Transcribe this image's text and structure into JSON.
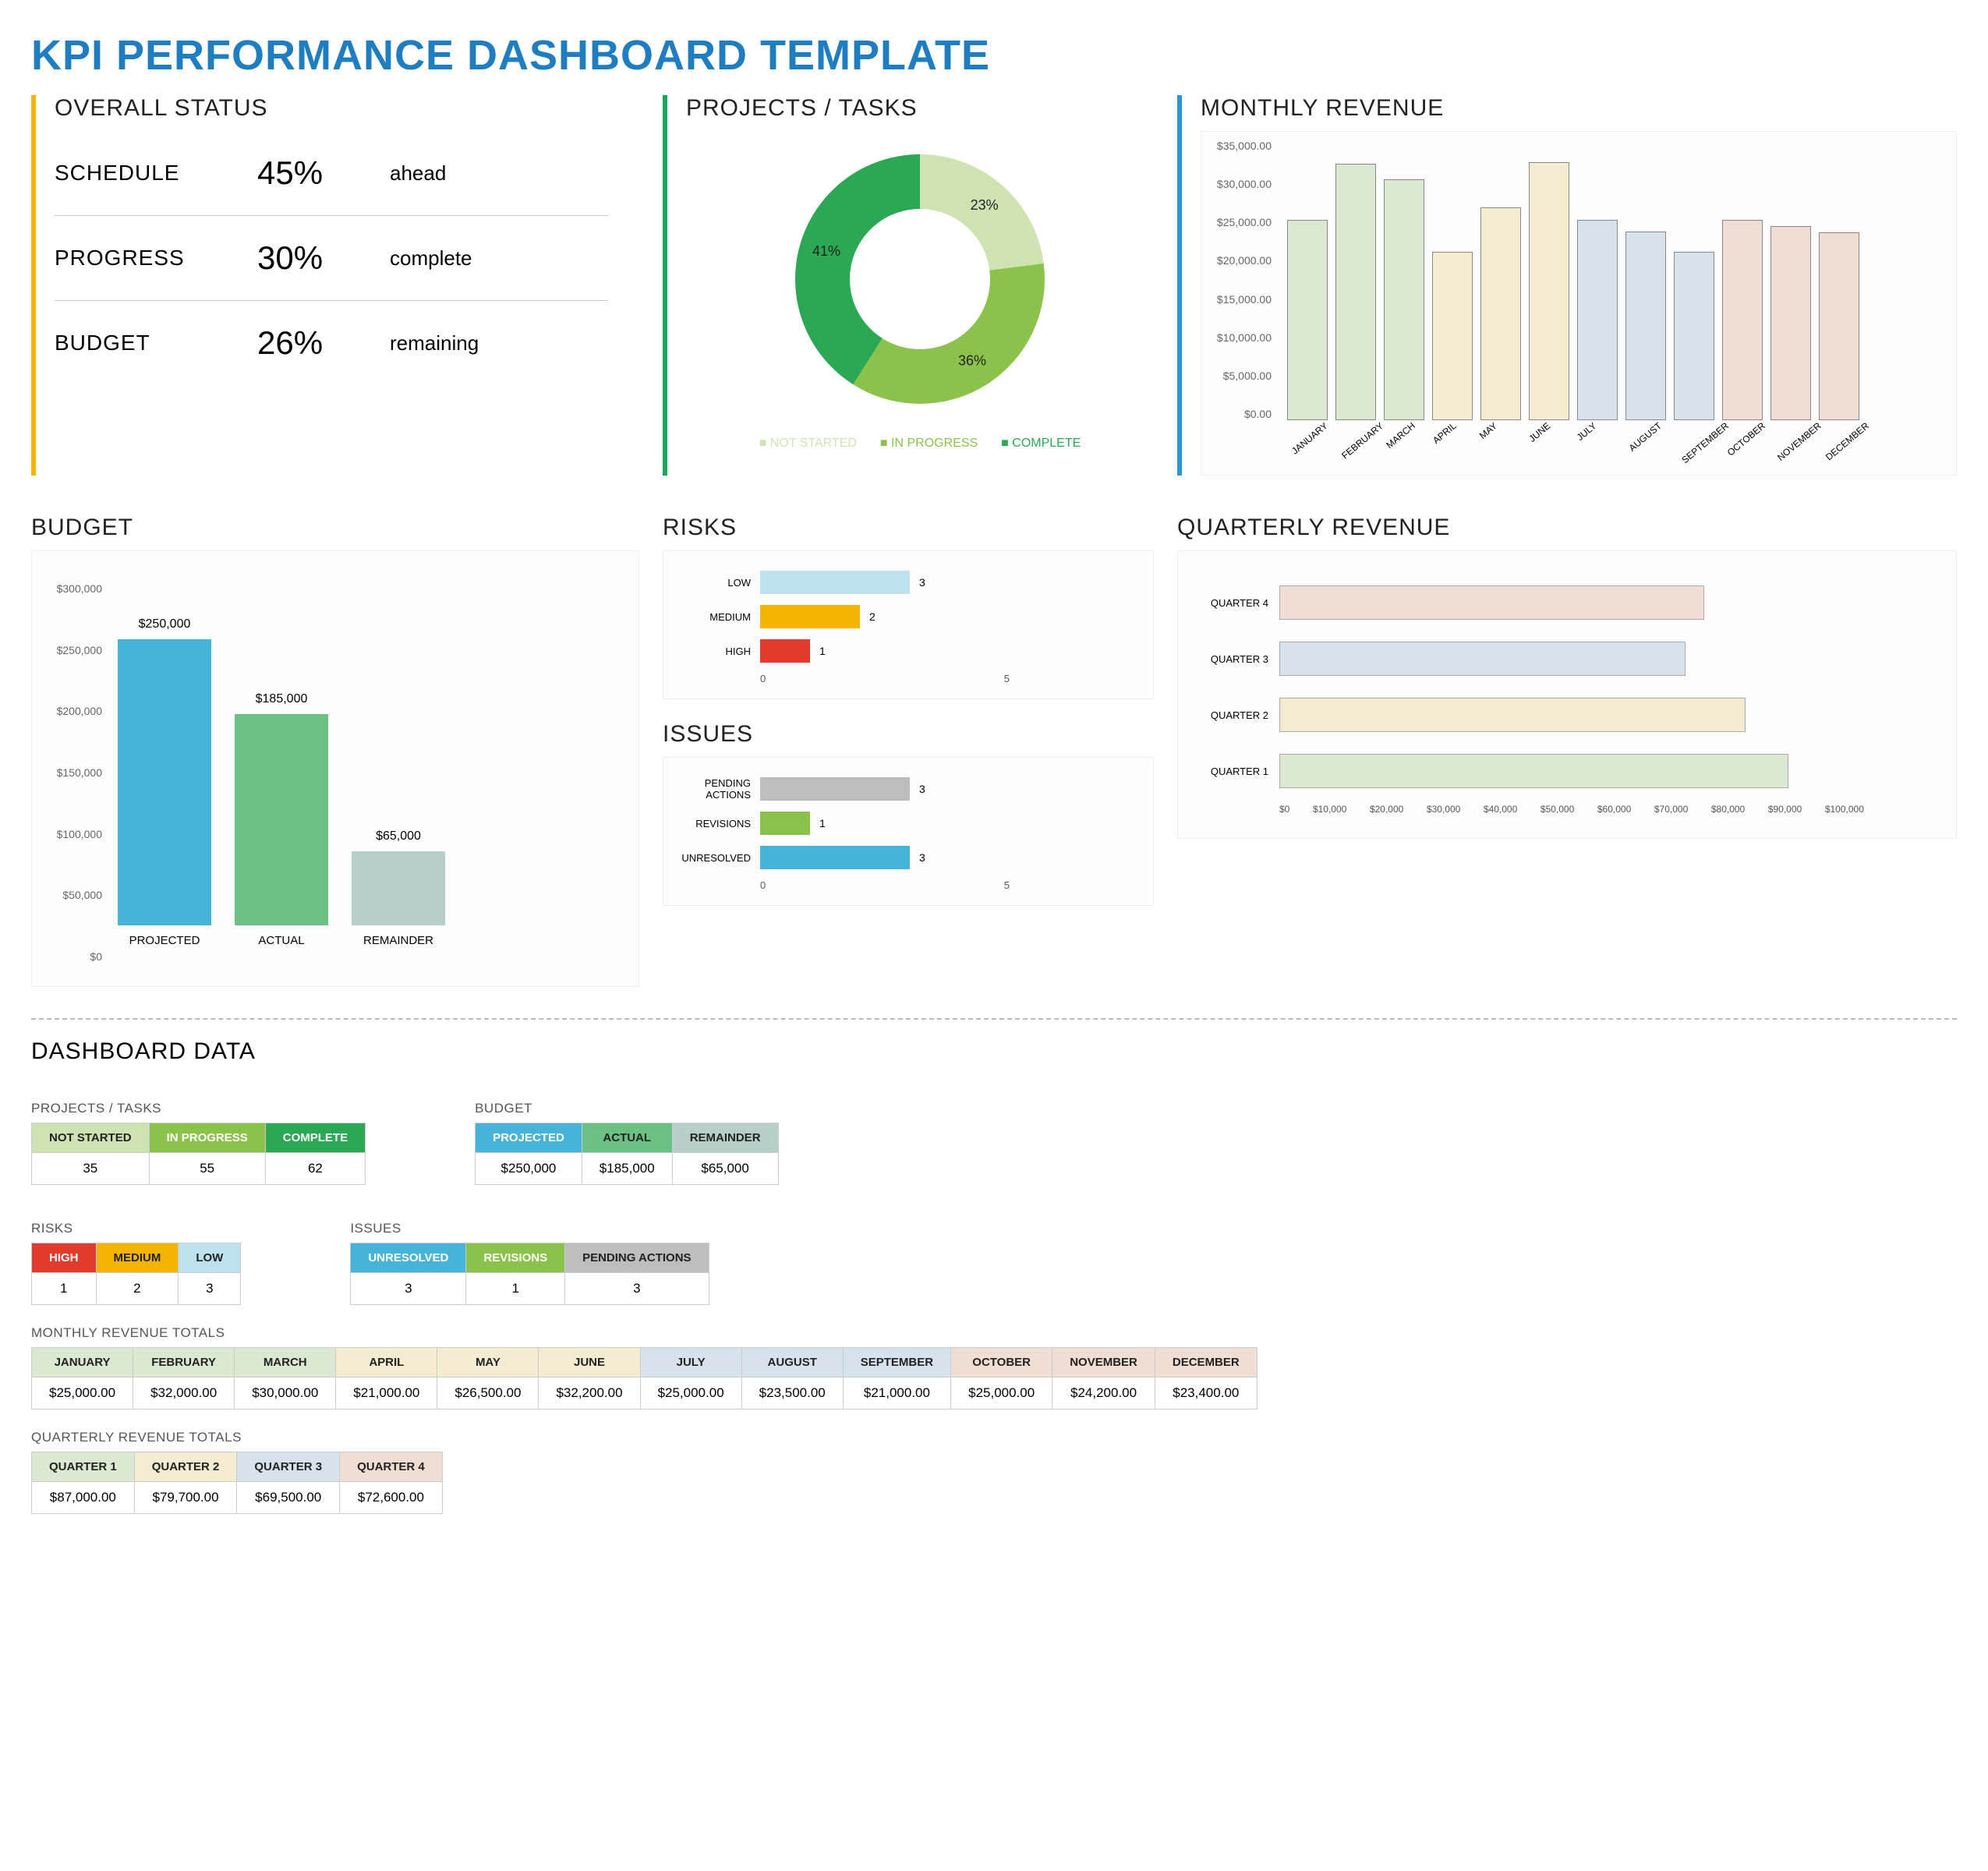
{
  "title": "KPI PERFORMANCE DASHBOARD TEMPLATE",
  "sections": {
    "overall": "OVERALL STATUS",
    "projects": "PROJECTS / TASKS",
    "monthly": "MONTHLY REVENUE",
    "budget": "BUDGET",
    "risks": "RISKS",
    "issues": "ISSUES",
    "quarterly": "QUARTERLY REVENUE",
    "dashdata": "DASHBOARD DATA"
  },
  "status": {
    "schedule": {
      "label": "SCHEDULE",
      "value": "45%",
      "text": "ahead"
    },
    "progress": {
      "label": "PROGRESS",
      "value": "30%",
      "text": "complete"
    },
    "budget": {
      "label": "BUDGET",
      "value": "26%",
      "text": "remaining"
    }
  },
  "projects_legend": {
    "ns": "NOT STARTED",
    "ip": "IN PROGRESS",
    "cp": "COMPLETE"
  },
  "dd": {
    "projects": {
      "title": "PROJECTS / TASKS",
      "headers": [
        "NOT STARTED",
        "IN PROGRESS",
        "COMPLETE"
      ],
      "values": [
        "35",
        "55",
        "62"
      ],
      "colors": [
        "#cde4b2",
        "#8bc34a",
        "#2aa854"
      ]
    },
    "budget": {
      "title": "BUDGET",
      "headers": [
        "PROJECTED",
        "ACTUAL",
        "REMAINDER"
      ],
      "values": [
        "$250,000",
        "$185,000",
        "$65,000"
      ],
      "colors": [
        "#46b4da",
        "#6bc084",
        "#b6cfc8"
      ]
    },
    "risks": {
      "title": "RISKS",
      "headers": [
        "HIGH",
        "MEDIUM",
        "LOW"
      ],
      "values": [
        "1",
        "2",
        "3"
      ],
      "colors": [
        "#e23b2e",
        "#f5b400",
        "#bde1ee"
      ]
    },
    "issues": {
      "title": "ISSUES",
      "headers": [
        "UNRESOLVED",
        "REVISIONS",
        "PENDING ACTIONS"
      ],
      "values": [
        "3",
        "1",
        "3"
      ],
      "colors": [
        "#46b4da",
        "#8bc34a",
        "#bdbdbd"
      ]
    },
    "monthly": {
      "title": "MONTHLY REVENUE TOTALS",
      "headers": [
        "JANUARY",
        "FEBRUARY",
        "MARCH",
        "APRIL",
        "MAY",
        "JUNE",
        "JULY",
        "AUGUST",
        "SEPTEMBER",
        "OCTOBER",
        "NOVEMBER",
        "DECEMBER"
      ],
      "values": [
        "$25,000.00",
        "$32,000.00",
        "$30,000.00",
        "$21,000.00",
        "$26,500.00",
        "$32,200.00",
        "$25,000.00",
        "$23,500.00",
        "$21,000.00",
        "$25,000.00",
        "$24,200.00",
        "$23,400.00"
      ],
      "colors": [
        "#dce9d2",
        "#dce9d2",
        "#dce9d2",
        "#f3ecd0",
        "#f3ecd0",
        "#f3ecd0",
        "#d6e3ed",
        "#d6e3ed",
        "#d6e3ed",
        "#f0ddd3",
        "#f0ddd3",
        "#f0ddd3"
      ]
    },
    "quarterly": {
      "title": "QUARTERLY REVENUE TOTALS",
      "headers": [
        "QUARTER 1",
        "QUARTER 2",
        "QUARTER 3",
        "QUARTER 4"
      ],
      "values": [
        "$87,000.00",
        "$79,700.00",
        "$69,500.00",
        "$72,600.00"
      ],
      "colors": [
        "#dce9d2",
        "#f3ecd0",
        "#d6e3ed",
        "#f0ddd3"
      ]
    }
  },
  "chart_data": [
    {
      "id": "projects_donut",
      "type": "pie",
      "title": "PROJECTS / TASKS",
      "slices": [
        {
          "name": "NOT STARTED",
          "pct": 23,
          "color": "#cde4b2"
        },
        {
          "name": "IN PROGRESS",
          "pct": 36,
          "color": "#8bc34a"
        },
        {
          "name": "COMPLETE",
          "pct": 41,
          "color": "#2aa854"
        }
      ]
    },
    {
      "id": "monthly_bar",
      "type": "bar",
      "title": "MONTHLY REVENUE",
      "ylabel": "",
      "xlabel": "",
      "ylim": [
        0,
        35000
      ],
      "yticks": [
        "$0.00",
        "$5,000.00",
        "$10,000.00",
        "$15,000.00",
        "$20,000.00",
        "$25,000.00",
        "$30,000.00",
        "$35,000.00"
      ],
      "categories": [
        "JANUARY",
        "FEBRUARY",
        "MARCH",
        "APRIL",
        "MAY",
        "JUNE",
        "JULY",
        "AUGUST",
        "SEPTEMBER",
        "OCTOBER",
        "NOVEMBER",
        "DECEMBER"
      ],
      "values": [
        25000,
        32000,
        30000,
        21000,
        26500,
        32200,
        25000,
        23500,
        21000,
        25000,
        24200,
        23400
      ],
      "colors": [
        "#dce9d2",
        "#dce9d2",
        "#dce9d2",
        "#f3ecd0",
        "#f3ecd0",
        "#f3ecd0",
        "#d6e3ed",
        "#d6e3ed",
        "#d6e3ed",
        "#f0ddd3",
        "#f0ddd3",
        "#f0ddd3"
      ]
    },
    {
      "id": "budget_bar",
      "type": "bar",
      "title": "BUDGET",
      "ylim": [
        0,
        300000
      ],
      "yticks": [
        "$0",
        "$50,000",
        "$100,000",
        "$150,000",
        "$200,000",
        "$250,000",
        "$300,000"
      ],
      "categories": [
        "PROJECTED",
        "ACTUAL",
        "REMAINDER"
      ],
      "values": [
        250000,
        185000,
        65000
      ],
      "labels": [
        "$250,000",
        "$185,000",
        "$65,000"
      ],
      "colors": [
        "#46b4da",
        "#6bc084",
        "#b6cfc8"
      ]
    },
    {
      "id": "risks_hbar",
      "type": "bar",
      "orientation": "h",
      "title": "RISKS",
      "xlim": [
        0,
        5
      ],
      "categories": [
        "LOW",
        "MEDIUM",
        "HIGH"
      ],
      "values": [
        3,
        2,
        1
      ],
      "colors": [
        "#bde1ee",
        "#f5b400",
        "#e23b2e"
      ]
    },
    {
      "id": "issues_hbar",
      "type": "bar",
      "orientation": "h",
      "title": "ISSUES",
      "xlim": [
        0,
        5
      ],
      "categories": [
        "PENDING ACTIONS",
        "REVISIONS",
        "UNRESOLVED"
      ],
      "values": [
        3,
        1,
        3
      ],
      "colors": [
        "#bdbdbd",
        "#8bc34a",
        "#46b4da"
      ]
    },
    {
      "id": "quarterly_hbar",
      "type": "bar",
      "orientation": "h",
      "title": "QUARTERLY REVENUE",
      "xlim": [
        0,
        100000
      ],
      "xticks": [
        "$0",
        "$10,000",
        "$20,000",
        "$30,000",
        "$40,000",
        "$50,000",
        "$60,000",
        "$70,000",
        "$80,000",
        "$90,000",
        "$100,000"
      ],
      "categories": [
        "QUARTER 4",
        "QUARTER 3",
        "QUARTER 2",
        "QUARTER 1"
      ],
      "values": [
        72600,
        69500,
        79700,
        87000
      ],
      "colors": [
        "#f0ddd3",
        "#d6e3ed",
        "#f3ecd0",
        "#dce9d2"
      ]
    }
  ]
}
